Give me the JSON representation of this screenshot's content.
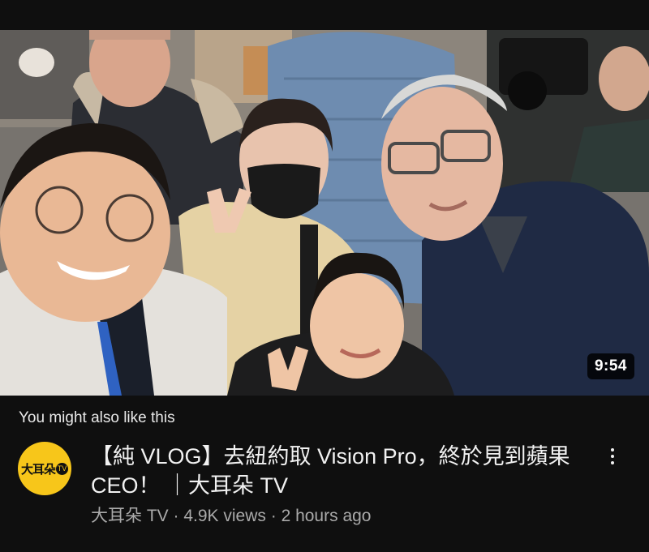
{
  "video": {
    "duration": "9:54"
  },
  "section": {
    "title": "You might also like this"
  },
  "channel": {
    "avatar_text": "大耳朵",
    "avatar_badge": "TV",
    "avatar_color": "#f7c61a"
  },
  "item": {
    "title": "【純 VLOG】去紐約取 Vision Pro，終於見到蘋果CEO！ ｜大耳朵 TV",
    "channel_name": "大耳朵 TV",
    "separator": " · ",
    "views": "4.9K views",
    "age": "2 hours ago"
  },
  "icons": {
    "more": "more-vert-icon"
  }
}
